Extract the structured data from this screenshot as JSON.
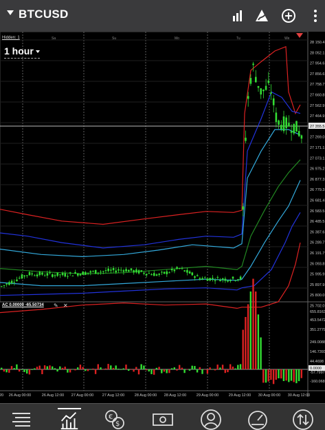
{
  "header": {
    "symbol": "BTCUSD",
    "icons": [
      "dropdown-caret",
      "bar-chart-icon",
      "indicator-icon",
      "add-icon",
      "more-vert-icon"
    ]
  },
  "chart": {
    "hidden_label": "Hidden: 1",
    "timeframe": "1 hour",
    "day_markers": [
      "Sa",
      "Su",
      "Mo",
      "Tu",
      "We"
    ],
    "price_labels": [
      "28 150.4",
      "28 052.1",
      "27 954.6",
      "27 856.6",
      "27 758.7",
      "27 660.8",
      "27 562.9",
      "27 464.9",
      "27 355.5",
      "27 269.0",
      "27 171.1",
      "27 073.1",
      "26 975.2",
      "26 877.3",
      "26 779.3",
      "26 681.4",
      "26 583.5",
      "26 485.5",
      "26 387.6",
      "26 289.7",
      "26 191.7",
      "26 093.8",
      "25 995.9",
      "25 897.9",
      "25 800.0",
      "25 702.0"
    ],
    "current_price": "27 355.5",
    "time_labels": [
      "20",
      "26 Aug 00:00",
      "26 Aug 12:00",
      "27 Aug 00:00",
      "27 Aug 12:00",
      "28 Aug 00:00",
      "28 Aug 12:00",
      "29 Aug 00:00",
      "29 Aug 12:00",
      "30 Aug 00:00",
      "30 Aug 12:00"
    ],
    "colors": {
      "bull": "#33dd33",
      "outer_band": "#dd2222",
      "mid_band": "#2233dd",
      "inner_band": "#33aadd",
      "ma": "#228822"
    }
  },
  "indicator": {
    "label": "AC 0.00000 -65.50734",
    "edit_icon": "pencil-icon",
    "close_icon": "close-icon",
    "scale_labels": [
      "655.8163",
      "453.5472",
      "351.2779",
      "249.0088",
      "146.7393",
      "44.4698",
      "0.0000",
      "-57.7997",
      "-160.0687"
    ]
  },
  "nav": {
    "items": [
      "quotes-list-icon",
      "chart-icon",
      "trade-icon",
      "history-icon",
      "account-icon",
      "speedometer-icon",
      "transfer-icon"
    ],
    "active": "chart-icon"
  }
}
